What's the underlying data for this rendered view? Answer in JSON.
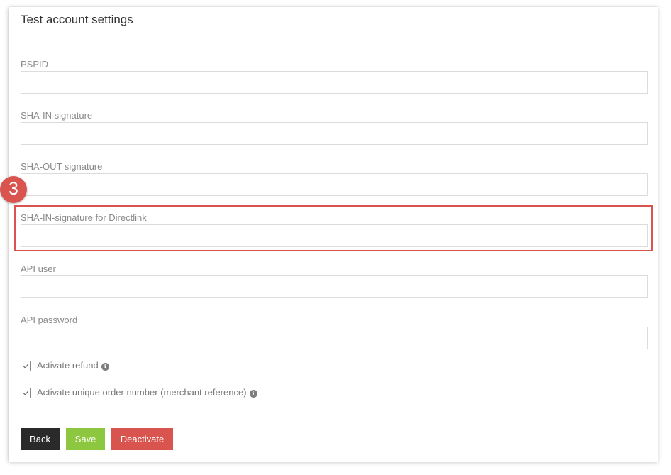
{
  "card": {
    "title": "Test account settings"
  },
  "fields": [
    {
      "label": "PSPID",
      "value": "",
      "placeholder": ""
    },
    {
      "label": "SHA-IN signature",
      "value": "",
      "placeholder": ""
    },
    {
      "label": "SHA-OUT signature",
      "value": "",
      "placeholder": ""
    },
    {
      "label": "SHA-IN-signature for Directlink",
      "value": "",
      "placeholder": ""
    },
    {
      "label": "API user",
      "value": "",
      "placeholder": ""
    },
    {
      "label": "API password",
      "value": "",
      "placeholder": ""
    }
  ],
  "annotation": {
    "step_number": "3",
    "color": "#d9534f"
  },
  "checkboxes": [
    {
      "label": "Activate refund",
      "checked": true,
      "icon": "info-icon"
    },
    {
      "label": "Activate unique order number (merchant reference)",
      "checked": true,
      "icon": "info-icon"
    }
  ],
  "buttons": {
    "back_label": "Back",
    "save_label": "Save",
    "deactivate_label": "Deactivate"
  },
  "colors": {
    "back": "#2a2a2a",
    "save": "#8dc63f",
    "deactivate": "#d9534f"
  }
}
